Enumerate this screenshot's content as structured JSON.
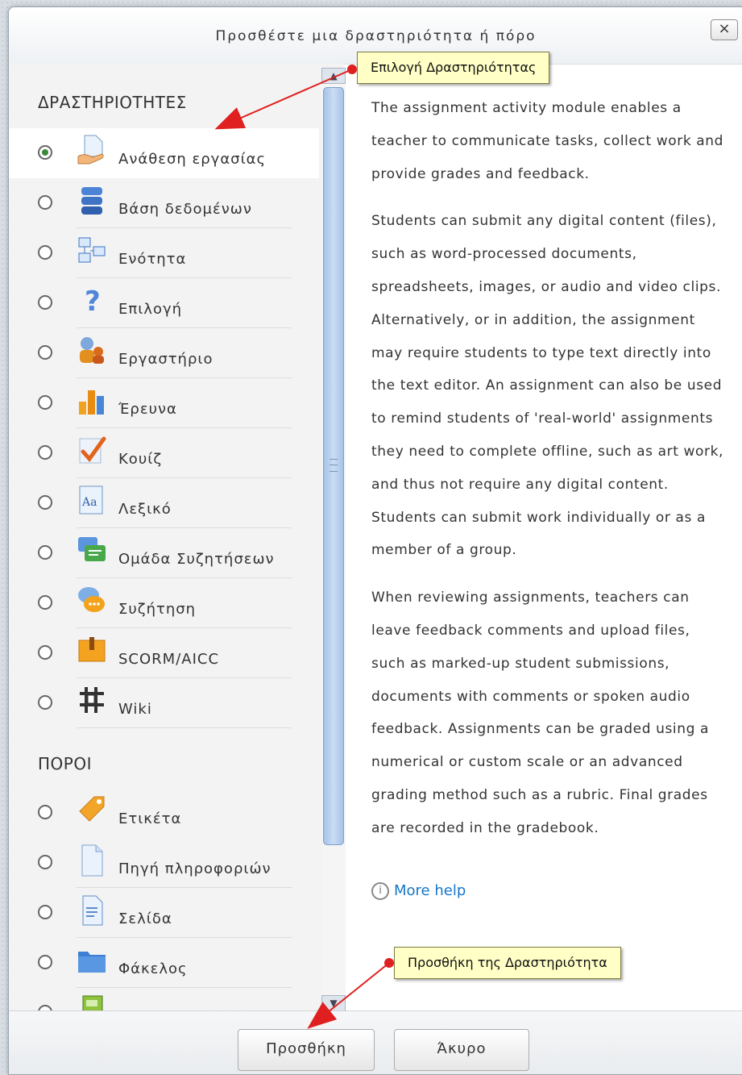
{
  "dialog": {
    "title": "Προσθέστε μια δραστηριότητα ή πόρο",
    "close_label": "×"
  },
  "activities": {
    "heading": "ΔΡΑΣΤΗΡΙΟΤΗΤΕΣ",
    "items": [
      {
        "label": "Ανάθεση εργασίας",
        "icon": "assignment-icon",
        "selected": true
      },
      {
        "label": "Βάση δεδομένων",
        "icon": "database-icon",
        "selected": false
      },
      {
        "label": "Ενότητα",
        "icon": "module-icon",
        "selected": false
      },
      {
        "label": "Επιλογή",
        "icon": "question-icon",
        "selected": false
      },
      {
        "label": "Εργαστήριο",
        "icon": "workshop-icon",
        "selected": false
      },
      {
        "label": "Έρευνα",
        "icon": "survey-chart-icon",
        "selected": false
      },
      {
        "label": "Κουίζ",
        "icon": "quiz-checkmark-icon",
        "selected": false
      },
      {
        "label": "Λεξικό",
        "icon": "glossary-icon",
        "selected": false
      },
      {
        "label": "Ομάδα Συζητήσεων",
        "icon": "forum-icon",
        "selected": false
      },
      {
        "label": "Συζήτηση",
        "icon": "chat-icon",
        "selected": false
      },
      {
        "label": "SCORM/AICC",
        "icon": "scorm-package-icon",
        "selected": false
      },
      {
        "label": "Wiki",
        "icon": "wiki-icon",
        "selected": false
      }
    ]
  },
  "resources": {
    "heading": "ΠΟΡΟΙ",
    "items": [
      {
        "label": "Ετικέτα",
        "icon": "label-tag-icon"
      },
      {
        "label": "Πηγή πληροφοριών",
        "icon": "file-icon"
      },
      {
        "label": "Σελίδα",
        "icon": "page-icon"
      },
      {
        "label": "Φάκελος",
        "icon": "folder-icon"
      },
      {
        "label": "",
        "icon": "book-icon"
      }
    ]
  },
  "description": {
    "paragraphs": [
      "The assignment activity module enables a teacher to communicate tasks, collect work and provide grades and feedback.",
      "Students can submit any digital content (files), such as word-processed documents, spreadsheets, images, or audio and video clips. Alternatively, or in addition, the assignment may require students to type text directly into the text editor. An assignment can also be used to remind students of 'real-world' assignments they need to complete offline, such as art work, and thus not require any digital content. Students can submit work individually or as a member of a group.",
      "When reviewing assignments, teachers can leave feedback comments and upload files, such as marked-up student submissions, documents with comments or spoken audio feedback. Assignments can be graded using a numerical or custom scale or an advanced grading method such as a rubric. Final grades are recorded in the gradebook."
    ],
    "help_link": "More help"
  },
  "footer": {
    "add_label": "Προσθήκη",
    "cancel_label": "Άκυρο"
  },
  "callouts": {
    "select_activity": "Επιλογή Δραστηριότητας",
    "add_activity": "Προσθήκη της Δραστηριότητα"
  },
  "colors": {
    "callout_bg": "#ffffc6",
    "arrow": "#e02020",
    "scroll_thumb": "#b7cdef",
    "help_link": "#1677c8"
  }
}
